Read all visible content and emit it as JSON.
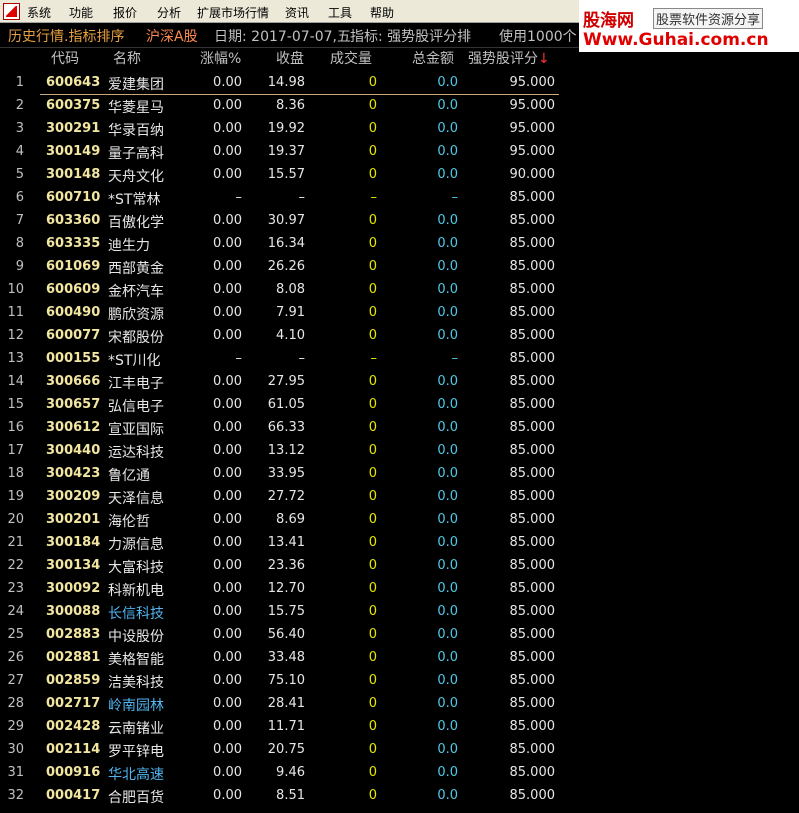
{
  "menu": {
    "items": [
      "系统",
      "功能",
      "报价",
      "分析",
      "扩展市场行情",
      "资讯",
      "工具",
      "帮助"
    ]
  },
  "banner": {
    "brand": "股海网",
    "tagline": "股票软件资源分享",
    "url": "Www.Guhai.com.cn"
  },
  "titlebar": {
    "mode": "历史行情.指标排序",
    "market": "沪深A股",
    "date": "日期: 2017-07-07,五",
    "indicator": "指标: 强势股评分排",
    "usage": "使用1000个"
  },
  "columns": {
    "code": "代码",
    "name": "名称",
    "pct": "涨幅%",
    "close": "收盘",
    "volume": "成交量",
    "amount": "总金额",
    "score": "强势股评分",
    "sort_arrow": "↓"
  },
  "rows": [
    {
      "idx": "1",
      "code": "600643",
      "name": "爱建集团",
      "pct": "0.00",
      "close": "14.98",
      "vol": "0",
      "amt": "0.0",
      "score": "95.000"
    },
    {
      "idx": "2",
      "code": "600375",
      "name": "华菱星马",
      "pct": "0.00",
      "close": "8.36",
      "vol": "0",
      "amt": "0.0",
      "score": "95.000"
    },
    {
      "idx": "3",
      "code": "300291",
      "name": "华录百纳",
      "pct": "0.00",
      "close": "19.92",
      "vol": "0",
      "amt": "0.0",
      "score": "95.000"
    },
    {
      "idx": "4",
      "code": "300149",
      "name": "量子高科",
      "pct": "0.00",
      "close": "19.37",
      "vol": "0",
      "amt": "0.0",
      "score": "95.000"
    },
    {
      "idx": "5",
      "code": "300148",
      "name": "天舟文化",
      "pct": "0.00",
      "close": "15.57",
      "vol": "0",
      "amt": "0.0",
      "score": "90.000"
    },
    {
      "idx": "6",
      "code": "600710",
      "name": "*ST常林",
      "pct": "–",
      "close": "–",
      "vol": "–",
      "amt": "–",
      "score": "85.000"
    },
    {
      "idx": "7",
      "code": "603360",
      "name": "百傲化学",
      "pct": "0.00",
      "close": "30.97",
      "vol": "0",
      "amt": "0.0",
      "score": "85.000"
    },
    {
      "idx": "8",
      "code": "603335",
      "name": "迪生力",
      "pct": "0.00",
      "close": "16.34",
      "vol": "0",
      "amt": "0.0",
      "score": "85.000"
    },
    {
      "idx": "9",
      "code": "601069",
      "name": "西部黄金",
      "pct": "0.00",
      "close": "26.26",
      "vol": "0",
      "amt": "0.0",
      "score": "85.000"
    },
    {
      "idx": "10",
      "code": "600609",
      "name": "金杯汽车",
      "pct": "0.00",
      "close": "8.08",
      "vol": "0",
      "amt": "0.0",
      "score": "85.000"
    },
    {
      "idx": "11",
      "code": "600490",
      "name": "鹏欣资源",
      "pct": "0.00",
      "close": "7.91",
      "vol": "0",
      "amt": "0.0",
      "score": "85.000"
    },
    {
      "idx": "12",
      "code": "600077",
      "name": "宋都股份",
      "pct": "0.00",
      "close": "4.10",
      "vol": "0",
      "amt": "0.0",
      "score": "85.000"
    },
    {
      "idx": "13",
      "code": "000155",
      "name": "*ST川化",
      "pct": "–",
      "close": "–",
      "vol": "–",
      "amt": "–",
      "score": "85.000"
    },
    {
      "idx": "14",
      "code": "300666",
      "name": "江丰电子",
      "pct": "0.00",
      "close": "27.95",
      "vol": "0",
      "amt": "0.0",
      "score": "85.000"
    },
    {
      "idx": "15",
      "code": "300657",
      "name": "弘信电子",
      "pct": "0.00",
      "close": "61.05",
      "vol": "0",
      "amt": "0.0",
      "score": "85.000"
    },
    {
      "idx": "16",
      "code": "300612",
      "name": "宣亚国际",
      "pct": "0.00",
      "close": "66.33",
      "vol": "0",
      "amt": "0.0",
      "score": "85.000"
    },
    {
      "idx": "17",
      "code": "300440",
      "name": "运达科技",
      "pct": "0.00",
      "close": "13.12",
      "vol": "0",
      "amt": "0.0",
      "score": "85.000"
    },
    {
      "idx": "18",
      "code": "300423",
      "name": "鲁亿通",
      "pct": "0.00",
      "close": "33.95",
      "vol": "0",
      "amt": "0.0",
      "score": "85.000"
    },
    {
      "idx": "19",
      "code": "300209",
      "name": "天泽信息",
      "pct": "0.00",
      "close": "27.72",
      "vol": "0",
      "amt": "0.0",
      "score": "85.000"
    },
    {
      "idx": "20",
      "code": "300201",
      "name": "海伦哲",
      "pct": "0.00",
      "close": "8.69",
      "vol": "0",
      "amt": "0.0",
      "score": "85.000"
    },
    {
      "idx": "21",
      "code": "300184",
      "name": "力源信息",
      "pct": "0.00",
      "close": "13.41",
      "vol": "0",
      "amt": "0.0",
      "score": "85.000"
    },
    {
      "idx": "22",
      "code": "300134",
      "name": "大富科技",
      "pct": "0.00",
      "close": "23.36",
      "vol": "0",
      "amt": "0.0",
      "score": "85.000"
    },
    {
      "idx": "23",
      "code": "300092",
      "name": "科新机电",
      "pct": "0.00",
      "close": "12.70",
      "vol": "0",
      "amt": "0.0",
      "score": "85.000"
    },
    {
      "idx": "24",
      "code": "300088",
      "name": "长信科技",
      "pct": "0.00",
      "close": "15.75",
      "vol": "0",
      "amt": "0.0",
      "score": "85.000",
      "highlight": true
    },
    {
      "idx": "25",
      "code": "002883",
      "name": "中设股份",
      "pct": "0.00",
      "close": "56.40",
      "vol": "0",
      "amt": "0.0",
      "score": "85.000"
    },
    {
      "idx": "26",
      "code": "002881",
      "name": "美格智能",
      "pct": "0.00",
      "close": "33.48",
      "vol": "0",
      "amt": "0.0",
      "score": "85.000"
    },
    {
      "idx": "27",
      "code": "002859",
      "name": "洁美科技",
      "pct": "0.00",
      "close": "75.10",
      "vol": "0",
      "amt": "0.0",
      "score": "85.000"
    },
    {
      "idx": "28",
      "code": "002717",
      "name": "岭南园林",
      "pct": "0.00",
      "close": "28.41",
      "vol": "0",
      "amt": "0.0",
      "score": "85.000",
      "highlight": true
    },
    {
      "idx": "29",
      "code": "002428",
      "name": "云南锗业",
      "pct": "0.00",
      "close": "11.71",
      "vol": "0",
      "amt": "0.0",
      "score": "85.000"
    },
    {
      "idx": "30",
      "code": "002114",
      "name": "罗平锌电",
      "pct": "0.00",
      "close": "20.75",
      "vol": "0",
      "amt": "0.0",
      "score": "85.000"
    },
    {
      "idx": "31",
      "code": "000916",
      "name": "华北高速",
      "pct": "0.00",
      "close": "9.46",
      "vol": "0",
      "amt": "0.0",
      "score": "85.000",
      "highlight": true
    },
    {
      "idx": "32",
      "code": "000417",
      "name": "合肥百货",
      "pct": "0.00",
      "close": "8.51",
      "vol": "0",
      "amt": "0.0",
      "score": "85.000"
    }
  ],
  "colors": {
    "background": "#000000",
    "code": "#f2e6a0",
    "volume": "#e6e600",
    "amount": "#50c8e6",
    "highlight_name": "#50b4f0",
    "title_orange": "#e8a040"
  }
}
